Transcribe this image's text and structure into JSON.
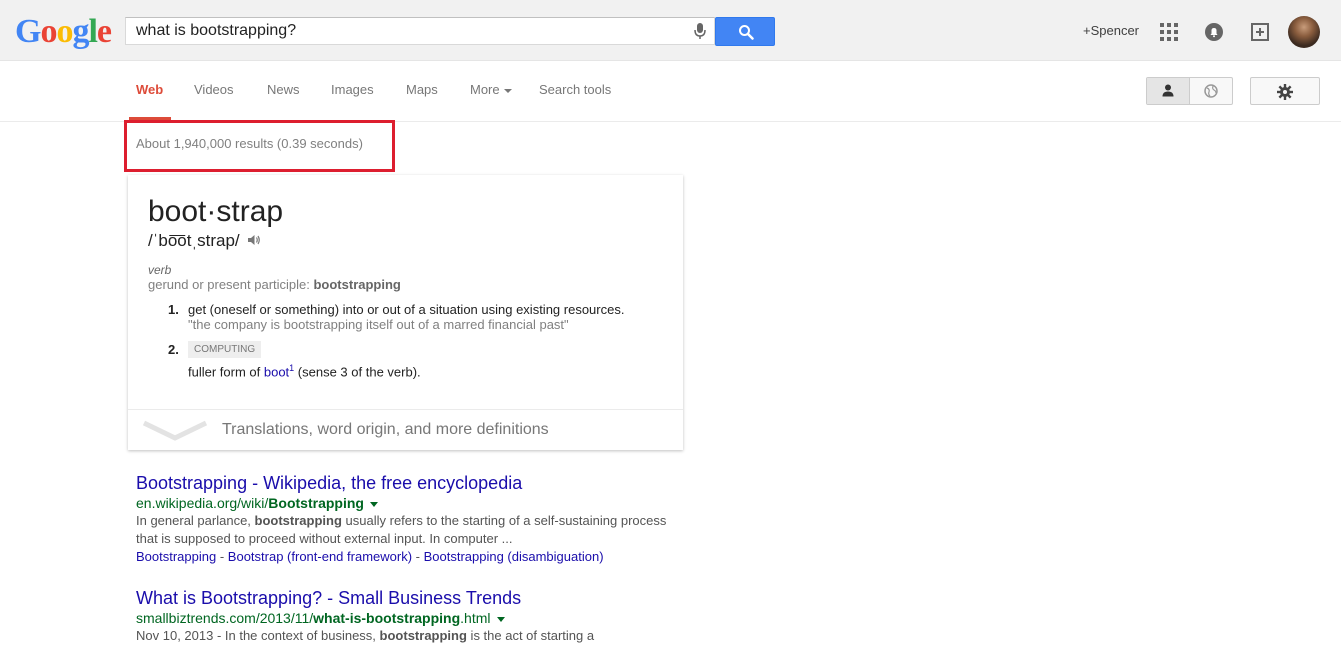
{
  "logo": {
    "letters": [
      "G",
      "o",
      "o",
      "g",
      "l",
      "e"
    ],
    "colors": [
      "#4285f4",
      "#ea4335",
      "#fbbc05",
      "#4285f4",
      "#34a853",
      "#ea4335"
    ]
  },
  "search": {
    "query": "what is bootstrapping?"
  },
  "header": {
    "user_link": "+Spencer"
  },
  "nav": {
    "tabs": [
      {
        "label": "Web"
      },
      {
        "label": "Videos"
      },
      {
        "label": "News"
      },
      {
        "label": "Images"
      },
      {
        "label": "Maps"
      },
      {
        "label": "More"
      },
      {
        "label": "Search tools"
      }
    ]
  },
  "stats": {
    "text": "About 1,940,000 results (0.39 seconds)"
  },
  "definition": {
    "word": "boot·strap",
    "phonetic": "/ˈbo͞otˌstrap/",
    "part_of_speech": "verb",
    "gerund_label": "gerund or present participle: ",
    "gerund_value": "bootstrapping",
    "senses": [
      {
        "num": "1.",
        "text": "get (oneself or something) into or out of a situation using existing resources.",
        "example": "\"the company is bootstrapping itself out of a marred financial past\""
      },
      {
        "num": "2.",
        "label": "COMPUTING",
        "text_before": "fuller form of ",
        "link": "boot",
        "sup": "1",
        "text_after": " (sense 3 of the verb)."
      }
    ],
    "more_link": "Translations, word origin, and more definitions"
  },
  "results": [
    {
      "title": "Bootstrapping - Wikipedia, the free encyclopedia",
      "url_prefix": "en.wikipedia.org/wiki/",
      "url_bold": "Bootstrapping",
      "url_suffix": "",
      "snippet_parts": [
        "In general parlance, ",
        "bootstrapping",
        " usually refers to the starting of a self-sustaining process that is supposed to proceed without external input. In computer ..."
      ],
      "sitelinks": [
        "Bootstrapping",
        "Bootstrap (front-end framework)",
        "Bootstrapping (disambiguation)"
      ],
      "sitelink_sep": " - "
    },
    {
      "title": "What is Bootstrapping? - Small Business Trends",
      "url_prefix": "smallbiztrends.com/2013/11/",
      "url_bold": "what-is-bootstrapping",
      "url_suffix": ".html",
      "snippet_parts": [
        "Nov 10, 2013 - In the context of business, ",
        "bootstrapping",
        " is the act of starting a"
      ]
    }
  ]
}
